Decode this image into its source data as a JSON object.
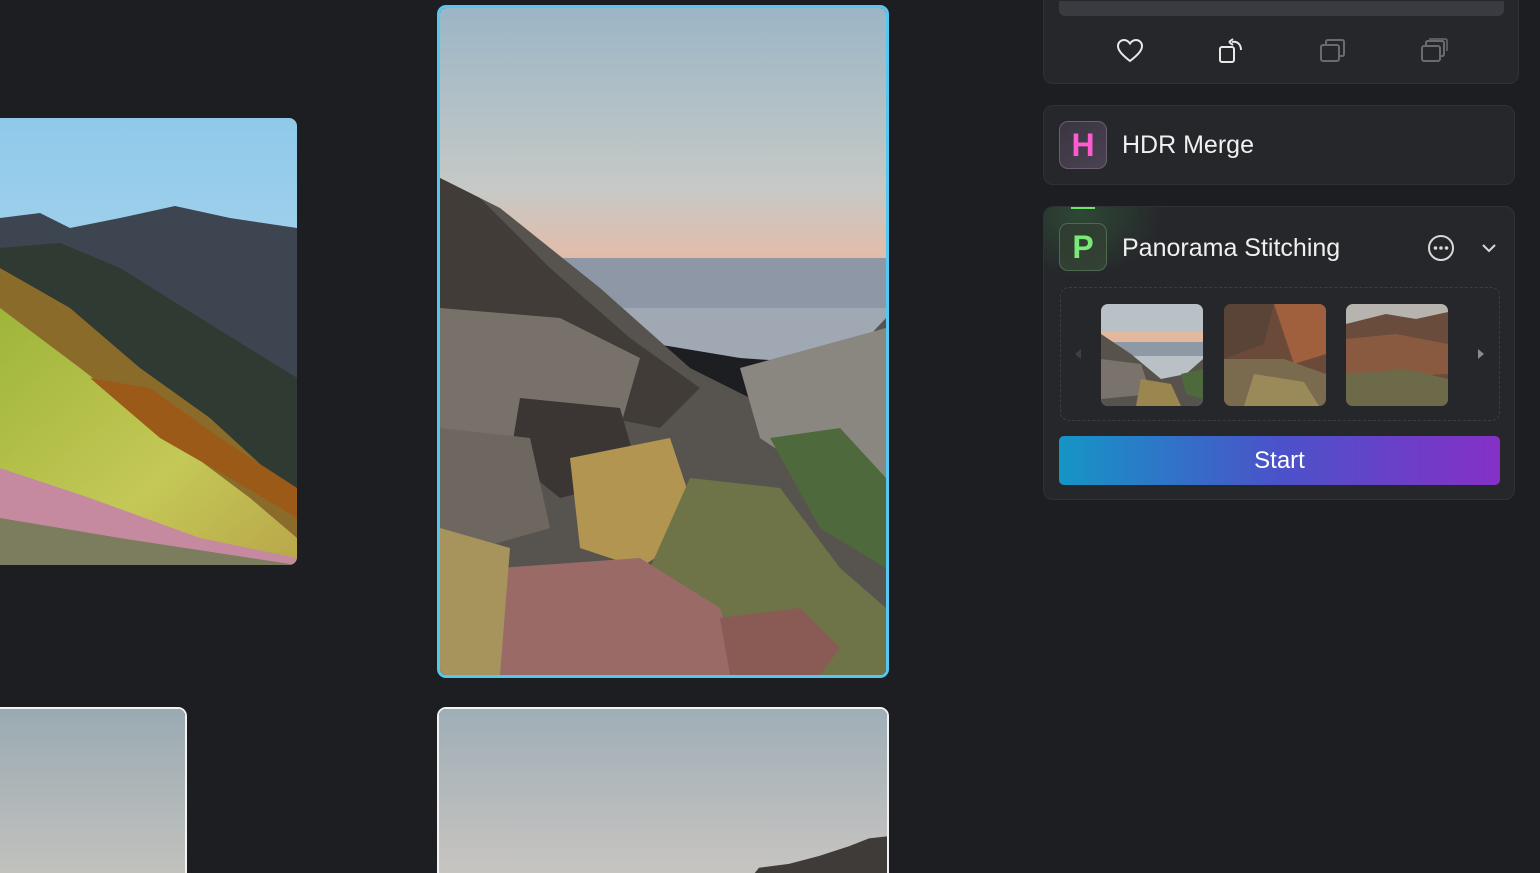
{
  "toolbar": {
    "icons": [
      "heart-icon",
      "rotate-icon",
      "copy-icon",
      "stack-icon"
    ]
  },
  "features": {
    "hdr": {
      "icon_letter": "H",
      "title": "HDR Merge",
      "color": "#ff5bd1"
    },
    "panorama": {
      "icon_letter": "P",
      "title": "Panorama Stitching",
      "color": "#7be87a",
      "thumbnails": [
        "thumb-1",
        "thumb-2",
        "thumb-3"
      ],
      "start_label": "Start"
    }
  },
  "colors": {
    "selection_border": "#55c8f2",
    "start_gradient": [
      "#1595c6",
      "#8530c6"
    ]
  }
}
